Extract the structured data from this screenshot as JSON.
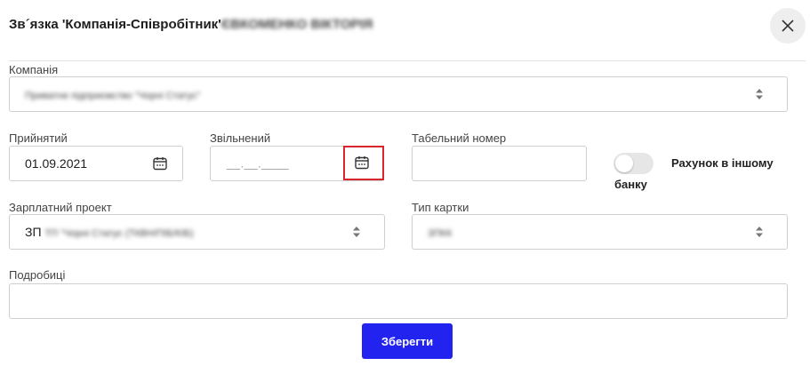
{
  "dialog": {
    "title": "Зв´язка 'Компанія-Співробітник'",
    "employee_name": "ЄВКОМЕНКО ВІКТОРІЯ",
    "save_label": "Зберегти"
  },
  "form": {
    "company": {
      "label": "Компанія",
      "value": "Приватне підприємство \"Чорні Статус\""
    },
    "hired": {
      "label": "Прийнятий",
      "value": "01.09.2021"
    },
    "fired": {
      "label": "Звільнений",
      "placeholder": "__.__.____"
    },
    "tab_number": {
      "label": "Табельний номер",
      "value": ""
    },
    "other_bank": {
      "label_line1": "Рахунок в іншому",
      "label_line2": "банку",
      "checked": false
    },
    "salary_project": {
      "label": "Зарплатний проект",
      "prefix": "ЗП",
      "value": "ТП \"Чорні Статус (ТКВН/ПІБ/КІБ)"
    },
    "card_type": {
      "label": "Тип картки",
      "value": "ЗПКК"
    },
    "details": {
      "label": "Подробиці",
      "value": ""
    }
  },
  "icons": {
    "close": "close-icon",
    "calendar": "calendar-icon",
    "select": "select-arrows-icon"
  },
  "colors": {
    "primary": "#2323f0",
    "highlight": "#d9262d",
    "border": "#cfcfcf"
  }
}
